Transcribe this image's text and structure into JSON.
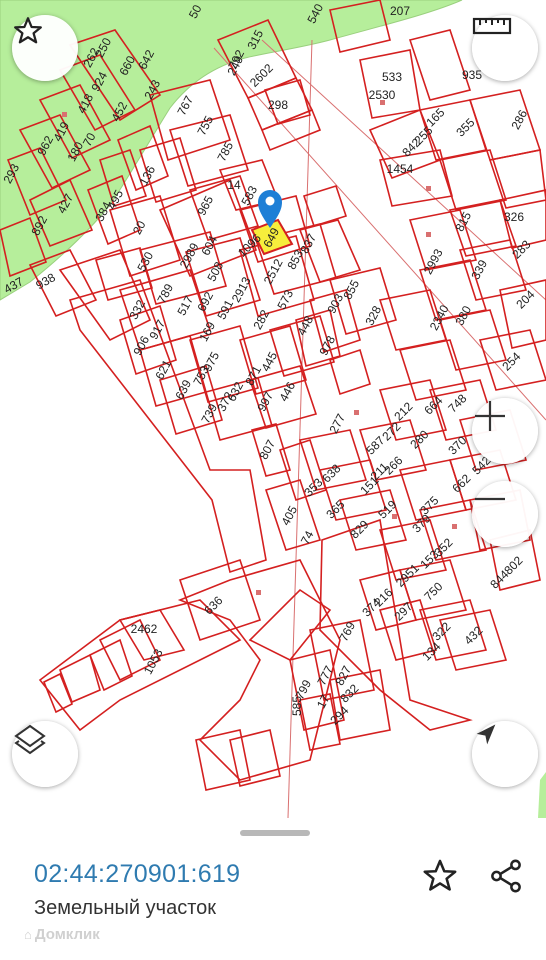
{
  "map": {
    "parcel_labels": [
      {
        "t": "250"
      },
      {
        "t": "262"
      },
      {
        "t": "642"
      },
      {
        "t": "660"
      },
      {
        "t": "243"
      },
      {
        "t": "924"
      },
      {
        "t": "418"
      },
      {
        "t": "452"
      },
      {
        "t": "419"
      },
      {
        "t": "962"
      },
      {
        "t": "70"
      },
      {
        "t": "180"
      },
      {
        "t": "293"
      },
      {
        "t": "427"
      },
      {
        "t": "892"
      },
      {
        "t": "495"
      },
      {
        "t": "384"
      },
      {
        "t": "136"
      },
      {
        "t": "20"
      },
      {
        "t": "530"
      },
      {
        "t": "938"
      },
      {
        "t": "437"
      },
      {
        "t": "315"
      },
      {
        "t": "249"
      },
      {
        "t": "2602"
      },
      {
        "t": "298"
      },
      {
        "t": "767"
      },
      {
        "t": "755"
      },
      {
        "t": "785"
      },
      {
        "t": "14"
      },
      {
        "t": "583"
      },
      {
        "t": "965"
      },
      {
        "t": "604"
      },
      {
        "t": "2989"
      },
      {
        "t": "508"
      },
      {
        "t": "1096"
      },
      {
        "t": "837"
      },
      {
        "t": "853"
      },
      {
        "t": "2512"
      },
      {
        "t": "2913"
      },
      {
        "t": "789"
      },
      {
        "t": "517"
      },
      {
        "t": "692"
      },
      {
        "t": "591"
      },
      {
        "t": "169"
      },
      {
        "t": "282"
      },
      {
        "t": "573"
      },
      {
        "t": "332"
      },
      {
        "t": "917"
      },
      {
        "t": "906"
      },
      {
        "t": "621"
      },
      {
        "t": "639"
      },
      {
        "t": "753"
      },
      {
        "t": "739"
      },
      {
        "t": "975"
      },
      {
        "t": "372"
      },
      {
        "t": "632"
      },
      {
        "t": "871"
      },
      {
        "t": "997"
      },
      {
        "t": "445"
      },
      {
        "t": "446"
      },
      {
        "t": "448"
      },
      {
        "t": "978"
      },
      {
        "t": "855"
      },
      {
        "t": "903"
      },
      {
        "t": "328"
      },
      {
        "t": "2993"
      },
      {
        "t": "2340"
      },
      {
        "t": "380"
      },
      {
        "t": "339"
      },
      {
        "t": "815"
      },
      {
        "t": "533"
      },
      {
        "t": "2530"
      },
      {
        "t": "935"
      },
      {
        "t": "165"
      },
      {
        "t": "255"
      },
      {
        "t": "842"
      },
      {
        "t": "355"
      },
      {
        "t": "1454"
      },
      {
        "t": "286"
      },
      {
        "t": "326"
      },
      {
        "t": "283"
      },
      {
        "t": "204"
      },
      {
        "t": "254"
      },
      {
        "t": "807"
      },
      {
        "t": "277"
      },
      {
        "t": "212"
      },
      {
        "t": "272"
      },
      {
        "t": "664"
      },
      {
        "t": "280"
      },
      {
        "t": "748"
      },
      {
        "t": "587"
      },
      {
        "t": "266"
      },
      {
        "t": "211"
      },
      {
        "t": "370"
      },
      {
        "t": "542"
      },
      {
        "t": "662"
      },
      {
        "t": "638"
      },
      {
        "t": "151"
      },
      {
        "t": "353"
      },
      {
        "t": "365"
      },
      {
        "t": "519"
      },
      {
        "t": "375"
      },
      {
        "t": "379"
      },
      {
        "t": "405"
      },
      {
        "t": "74"
      },
      {
        "t": "829"
      },
      {
        "t": "352"
      },
      {
        "t": "153"
      },
      {
        "t": "2951"
      },
      {
        "t": "750"
      },
      {
        "t": "216"
      },
      {
        "t": "374"
      },
      {
        "t": "297"
      },
      {
        "t": "322"
      },
      {
        "t": "134"
      },
      {
        "t": "432"
      },
      {
        "t": "844"
      },
      {
        "t": "802"
      },
      {
        "t": "636"
      },
      {
        "t": "2462"
      },
      {
        "t": "1053"
      },
      {
        "t": "799"
      },
      {
        "t": "777"
      },
      {
        "t": "769"
      },
      {
        "t": "17"
      },
      {
        "t": "827"
      },
      {
        "t": "585"
      },
      {
        "t": "832"
      },
      {
        "t": "294"
      },
      {
        "t": "207"
      },
      {
        "t": "540"
      },
      {
        "t": "50"
      },
      {
        "t": "792"
      },
      {
        "t": "649"
      },
      {
        "t": "619"
      }
    ],
    "colors": {
      "parcel_stroke": "#d42020",
      "forest_fill": "#b6ee9b",
      "selected_fill": "#f7ee3c",
      "pin": "#1e7fd6",
      "accent_text": "#2f7bb0"
    }
  },
  "controls": {
    "favorite_icon": "star-icon",
    "ruler_icon": "ruler-icon",
    "zoom_in_icon": "plus-icon",
    "zoom_out_icon": "minus-icon",
    "layers_icon": "layers-icon",
    "location_icon": "navigation-arrow-icon"
  },
  "sheet": {
    "cadastral_number": "02:44:270901:619",
    "property_type": "Земельный участок",
    "watermark": "Домклик",
    "favorite_icon": "star-icon",
    "share_icon": "share-icon"
  }
}
